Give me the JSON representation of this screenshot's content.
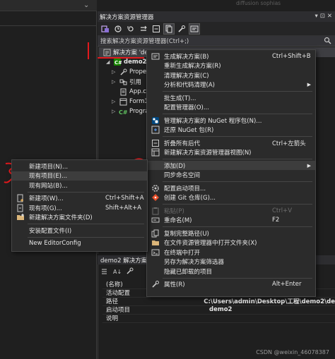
{
  "header": {
    "faint_text": "diffusion sophias",
    "left_tab_glyph": "⌄"
  },
  "solution_explorer": {
    "title": "解决方案资源管理器",
    "search_placeholder": "搜索解决方案资源管理器(Ctrl+;)",
    "solution_label": "解决方案 'de",
    "project": "demo2",
    "children": [
      "Prope",
      "引用",
      "App.co",
      "Form1",
      "Progra"
    ],
    "title_buttons": [
      "▾",
      "⊡",
      "✕"
    ]
  },
  "main_menu": {
    "items": [
      {
        "label": "生成解决方案(B)",
        "shortcut": "Ctrl+Shift+B",
        "icon": "build-icon"
      },
      {
        "label": "重新生成解决方案(R)",
        "shortcut": ""
      },
      {
        "label": "清理解决方案(C)",
        "shortcut": ""
      },
      {
        "label": "分析和代码清理(A)",
        "shortcut": "",
        "submenu": true
      },
      {
        "label": "批生成(T)...",
        "shortcut": ""
      },
      {
        "label": "配置管理器(O)...",
        "shortcut": ""
      },
      {
        "label": "管理解决方案的 NuGet 程序包(N)...",
        "shortcut": "",
        "icon": "nuget-icon"
      },
      {
        "label": "还原 NuGet 包(R)",
        "shortcut": "",
        "icon": "restore-icon"
      },
      {
        "label": "折叠所有后代",
        "shortcut": "Ctrl+左箭头",
        "icon": "collapse-icon"
      },
      {
        "label": "新建解决方案资源管理器视图(N)",
        "shortcut": "",
        "icon": "new-view-icon"
      },
      {
        "label": "添加(D)",
        "shortcut": "",
        "submenu": true,
        "highlighted": true
      },
      {
        "label": "同步命名空间",
        "shortcut": ""
      },
      {
        "label": "配置启动项目...",
        "shortcut": "",
        "icon": "gear-icon"
      },
      {
        "label": "创建 Git 仓库(G)...",
        "shortcut": "",
        "icon": "git-icon"
      },
      {
        "label": "粘贴(P)",
        "shortcut": "Ctrl+V",
        "icon": "paste-icon",
        "disabled": true
      },
      {
        "label": "重命名(M)",
        "shortcut": "F2",
        "icon": "rename-icon"
      },
      {
        "label": "复制完整路径(U)",
        "shortcut": "",
        "icon": "copy-path-icon"
      },
      {
        "label": "在文件资源管理器中打开文件夹(X)",
        "shortcut": "",
        "icon": "folder-open-icon"
      },
      {
        "label": "在终端中打开",
        "shortcut": "",
        "icon": "terminal-icon"
      },
      {
        "label": "另存为解决方案筛选器",
        "shortcut": ""
      },
      {
        "label": "隐藏已卸载的项目",
        "shortcut": ""
      },
      {
        "label": "属性(R)",
        "shortcut": "Alt+Enter",
        "icon": "wrench-icon"
      }
    ]
  },
  "sub_menu": {
    "items": [
      {
        "label": "新建项目(N)...",
        "shortcut": ""
      },
      {
        "label": "现有项目(E)...",
        "shortcut": "",
        "highlighted": true
      },
      {
        "label": "现有网站(B)...",
        "shortcut": ""
      },
      {
        "label": "新建项(W)...",
        "shortcut": "Ctrl+Shift+A",
        "icon": "new-item-icon"
      },
      {
        "label": "现有项(G)...",
        "shortcut": "Shift+Alt+A",
        "icon": "existing-item-icon"
      },
      {
        "label": "新建解决方案文件夹(D)",
        "shortcut": "",
        "icon": "new-folder-icon"
      },
      {
        "label": "安装配置文件(I)",
        "shortcut": ""
      },
      {
        "label": "New EditorConfig",
        "shortcut": ""
      }
    ]
  },
  "properties": {
    "header": "demo2 解决方案属",
    "rows": [
      {
        "key": "(名称)",
        "value": ""
      },
      {
        "key": "活动配置",
        "value": ""
      },
      {
        "key": "路径",
        "value": "C:\\Users\\admin\\Desktop\\工程\\demo2\\de"
      },
      {
        "key": "启动项目",
        "value": "demo2"
      },
      {
        "key": "说明",
        "value": ""
      }
    ]
  },
  "annotations": {
    "num1": "1",
    "num2": "2",
    "num3": "3"
  },
  "watermark": "CSDN @weixin_46078387",
  "colors": {
    "red": "#e2191d",
    "menu_bg": "#2b2b2b",
    "highlight": "#3d3d3d"
  }
}
